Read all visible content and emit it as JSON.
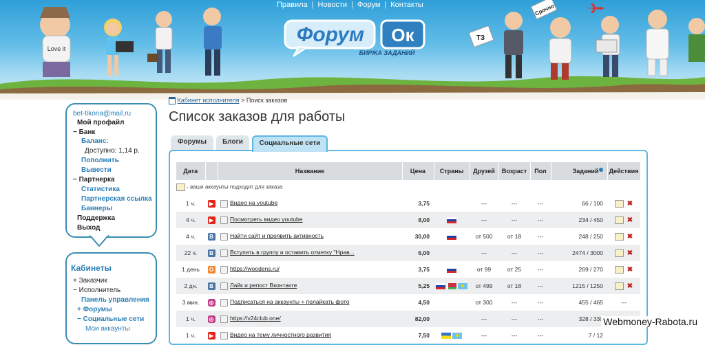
{
  "topnav": {
    "items": [
      "Правила",
      "Новости",
      "Форум",
      "Контакты"
    ],
    "separator": "|"
  },
  "logo": {
    "word": "Форум",
    "badge": "Ок",
    "tagline": "БИРЖА ЗАДАНИЙ"
  },
  "header_signs": {
    "srochno": "Срочно",
    "love": "Love it",
    "tz": "ТЗ"
  },
  "user_panel": {
    "email": "bet-tikona@mail.ru",
    "profile": "Мой профайл",
    "bank": "Банк",
    "balance_label": "Баланс:",
    "available": "Доступно: 1,14 р.",
    "topup": "Пополнить",
    "withdraw": "Вывести",
    "partner": "Партнерка",
    "stats": "Статистика",
    "partner_link": "Партнерская ссылка",
    "banners": "Баннеры",
    "support": "Поддержка",
    "logout": "Выход"
  },
  "cabinets": {
    "title": "Кабинеты",
    "customer": "Заказчик",
    "executor": "Исполнитель",
    "control_panel": "Панель управления",
    "forums": "Форумы",
    "social": "Социальные сети",
    "my_accounts": "Мои аккаунты"
  },
  "breadcrumb": {
    "home": "Кабинет исполнителя",
    "sep": ">",
    "current": "Поиск заказов"
  },
  "page_title": "Список заказов для работы",
  "tabs": [
    "Форумы",
    "Блоги",
    "Социальные сети"
  ],
  "table": {
    "headers": [
      "Дата",
      "Название",
      "Цена",
      "Страны",
      "Друзей",
      "Возраст",
      "Пол",
      "Заданий",
      "Действия"
    ],
    "note": "- ваши аккаунты подходят для заказа",
    "rows": [
      {
        "date": "1 ч.",
        "net": "yt",
        "name": "Видео на youtube",
        "price": "3,75",
        "flags": [],
        "friends": "---",
        "age": "---",
        "sex": "---",
        "tasks": "66 / 100",
        "actions": true
      },
      {
        "date": "4 ч.",
        "net": "yt",
        "name": "Посмотреть видео youtube",
        "price": "8,00",
        "flags": [
          "ru"
        ],
        "friends": "---",
        "age": "---",
        "sex": "---",
        "tasks": "234 / 450",
        "actions": true
      },
      {
        "date": "4 ч.",
        "net": "vk",
        "name": "Найти сайт и проявить активность",
        "price": "30,00",
        "flags": [
          "ru"
        ],
        "friends": "от 500",
        "age": "от 18",
        "sex": "---",
        "tasks": "248 / 250",
        "actions": true
      },
      {
        "date": "22 ч.",
        "net": "vk",
        "name": "Вступить в группу и оставить отметку \"Нрав...",
        "price": "6,00",
        "flags": [],
        "friends": "---",
        "age": "---",
        "sex": "---",
        "tasks": "2474 / 3000",
        "actions": true
      },
      {
        "date": "1 день",
        "net": "ok",
        "name": "https://woodens.ru/",
        "price": "3,75",
        "flags": [
          "ru"
        ],
        "friends": "от 99",
        "age": "от 25",
        "sex": "---",
        "tasks": "269 / 270",
        "actions": true
      },
      {
        "date": "2 дн.",
        "net": "vk",
        "name": "Лайк и репост Вконтакте",
        "price": "5,25",
        "flags": [
          "ru",
          "by",
          "kz"
        ],
        "friends": "от 499",
        "age": "от 18",
        "sex": "---",
        "tasks": "1215 / 1250",
        "actions": true
      },
      {
        "date": "3 мин.",
        "net": "ig",
        "name": "Подписаться на аккаунты + полайкать фото",
        "price": "4,50",
        "flags": [],
        "friends": "от 300",
        "age": "---",
        "sex": "---",
        "tasks": "455 / 465",
        "actions": false,
        "placeholder": "---"
      },
      {
        "date": "1 ч.",
        "net": "ig",
        "name": "https://v24club.one/",
        "price": "82,00",
        "flags": [],
        "friends": "---",
        "age": "---",
        "sex": "---",
        "tasks": "328 / 330",
        "actions": false,
        "placeholder": "---"
      },
      {
        "date": "1 ч.",
        "net": "yt",
        "name": "Видео на тему личностного развития",
        "price": "7,50",
        "flags": [
          "ua",
          "kz"
        ],
        "friends": "---",
        "age": "---",
        "sex": "---",
        "tasks": "7 / 12",
        "actions": false,
        "placeholder": ""
      }
    ]
  },
  "watermark": "Webmoney-Rabota.ru",
  "colors": {
    "accent": "#2a7fb6",
    "panel_border": "#3a8db3",
    "tab_active": "#bfe3f5",
    "delete": "#c21d1d",
    "yt": "#e62117",
    "vk": "#4a76a8",
    "ok": "#f2862e",
    "ig": "#c13584"
  }
}
